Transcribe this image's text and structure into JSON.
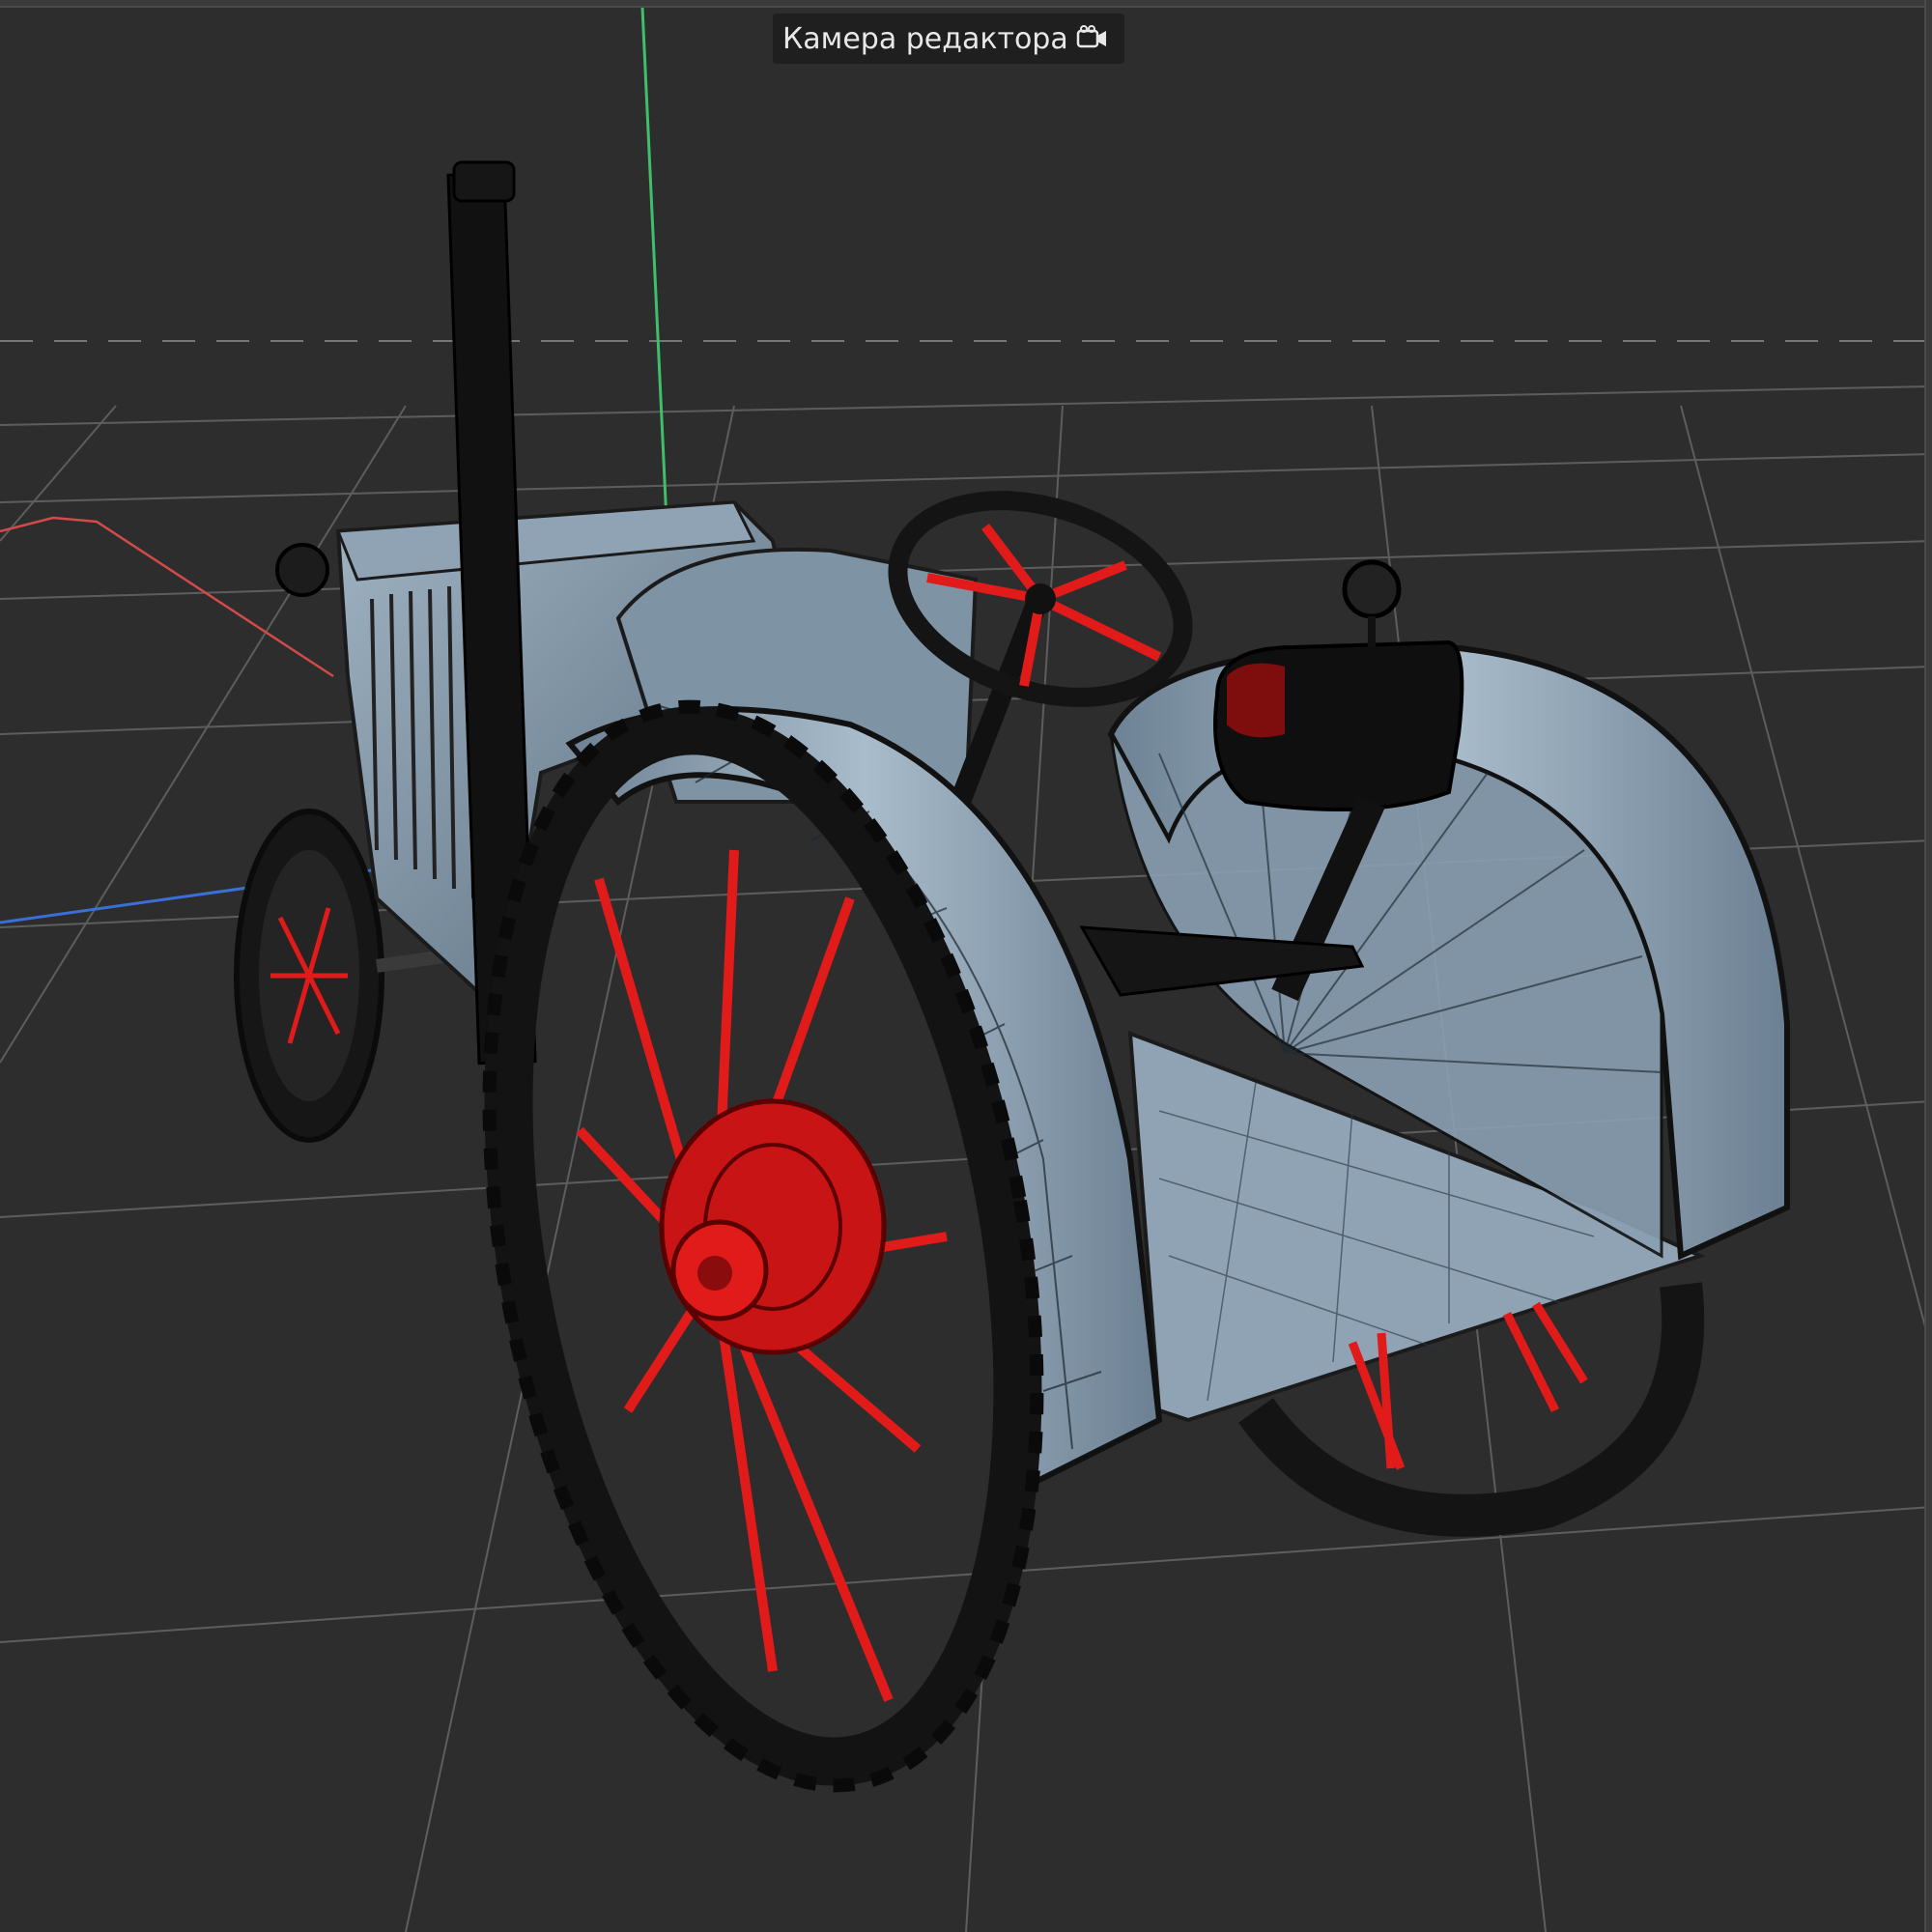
{
  "viewport": {
    "camera_label": "Камера редактора",
    "camera_icon": "video-camera-icon"
  },
  "colors": {
    "background": "#2d2d2d",
    "grid": "#6a6a6a",
    "axis_x": "#d24a4a",
    "axis_y": "#3fbf6a",
    "axis_z": "#3a6fd6",
    "body": "#7f95a6",
    "wheel_rim": "#1a1a1a",
    "spokes": "#e11a1a"
  }
}
